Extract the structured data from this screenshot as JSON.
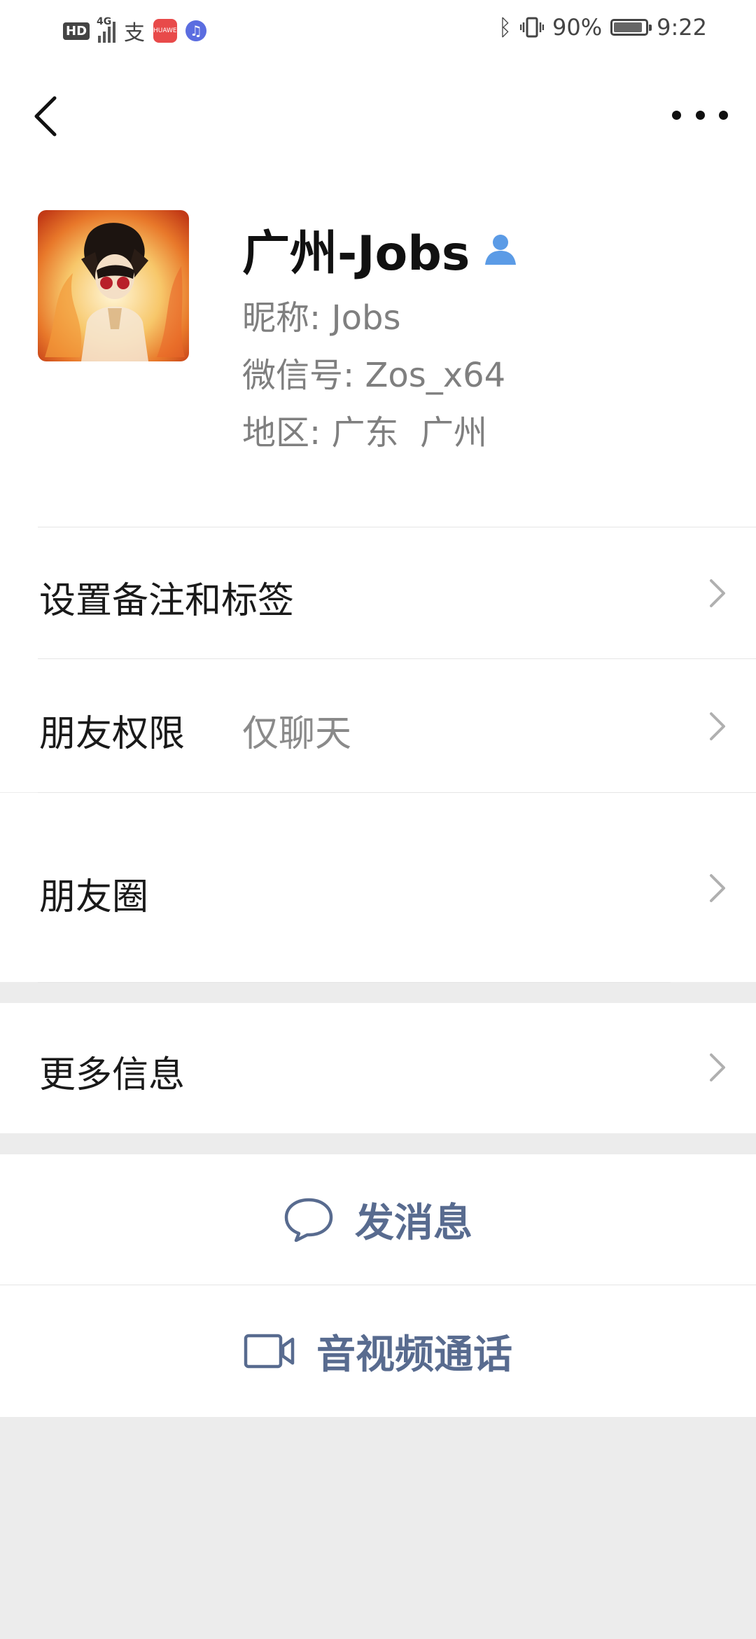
{
  "status_bar": {
    "hd_label": "HD",
    "network_label": "4G",
    "alipay_glyph": "支",
    "huawei_label": "HUAWEI",
    "music_glyph": "♫",
    "bluetooth_glyph": "ᛒ",
    "battery_percent": "90%",
    "battery_level": 0.9,
    "time": "9:22"
  },
  "header": {
    "back_icon": "chevron-left-icon",
    "more_icon": "ellipsis-icon"
  },
  "profile": {
    "display_name": "广州-Jobs",
    "nickname_label": "昵称:",
    "nickname_value": "Jobs",
    "wechat_id_label": "微信号:",
    "wechat_id_value": "Zos_x64",
    "region_label": "地区:",
    "region_value": "广东  广州",
    "contact_icon": "person-icon",
    "contact_icon_color": "#5b9be6"
  },
  "menu": {
    "remark_label": "设置备注和标签",
    "permission_label": "朋友权限",
    "permission_value": "仅聊天",
    "moments_label": "朋友圈",
    "more_info_label": "更多信息"
  },
  "actions": {
    "send_message_label": "发消息",
    "send_message_icon": "chat-bubble-icon",
    "call_label": "音视频通话",
    "call_icon": "video-camera-icon",
    "accent_color": "#586b8f"
  }
}
